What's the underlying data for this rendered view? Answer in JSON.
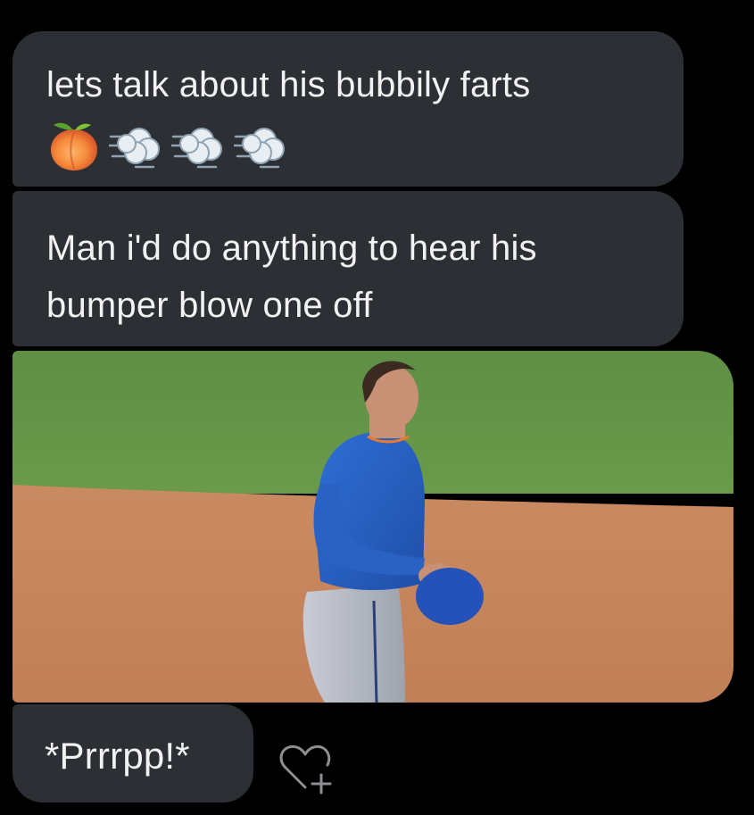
{
  "messages": [
    {
      "text": "lets talk about his bubbily farts",
      "emojis": [
        "peach-emoji",
        "dashing-away-emoji",
        "dashing-away-emoji",
        "dashing-away-emoji"
      ]
    },
    {
      "text": "Man i'd do anything to hear his bumper blow one off"
    },
    {
      "image": "baseball-player-photo"
    },
    {
      "text": "*Prrrpp!*"
    }
  ],
  "reaction_icon": "heart-plus-icon",
  "colors": {
    "background": "#000000",
    "bubble": "#2c2f33",
    "text": "#f2f2f2",
    "icon": "#8e8e93"
  }
}
